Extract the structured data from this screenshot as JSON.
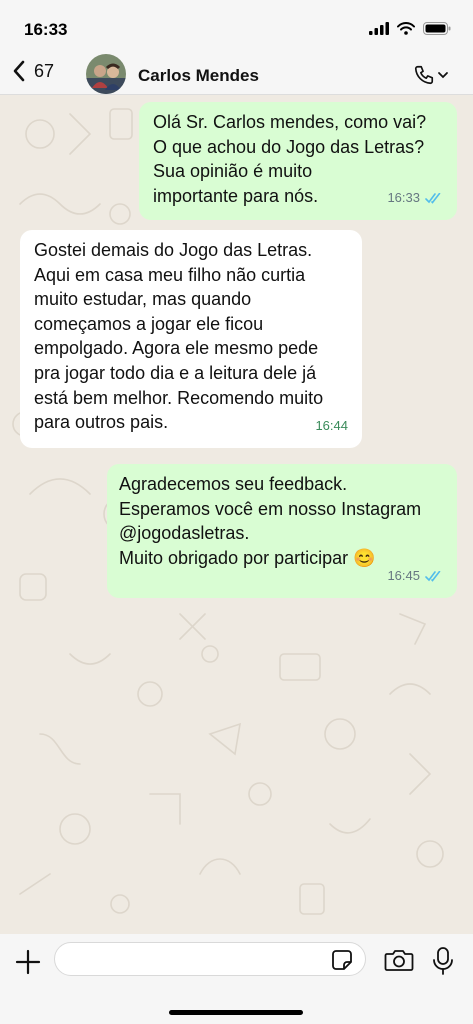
{
  "status_bar": {
    "time": "16:33"
  },
  "header": {
    "back_count": "67",
    "contact_name": "Carlos Mendes"
  },
  "messages": [
    {
      "direction": "outgoing",
      "text": "Olá Sr. Carlos mendes, como vai?\nO que achou do Jogo das Letras?\nSua opinião é muito\nimportante para nós.",
      "time": "16:33",
      "read": true
    },
    {
      "direction": "incoming",
      "text": "Gostei demais do Jogo das Letras.\nAqui em casa meu filho não curtia\nmuito estudar, mas quando\ncomeçamos a jogar ele ficou\nempolgado. Agora ele mesmo pede\npra jogar todo dia e a leitura dele já\nestá bem melhor. Recomendo muito\npara outros pais.",
      "time": "16:44"
    },
    {
      "direction": "outgoing",
      "text": "Agradecemos seu feedback.\nEsperamos você em nosso Instagram\n@jogodasletras.\nMuito obrigado por participar 😊",
      "time": "16:45",
      "read": true
    }
  ],
  "composer": {
    "placeholder": ""
  },
  "colors": {
    "outgoing_bubble": "#d9fdd3",
    "incoming_bubble": "#ffffff",
    "wallpaper": "#efeae2",
    "read_ticks": "#53bdeb"
  },
  "icons": [
    "signal-icon",
    "wifi-icon",
    "battery-icon",
    "back-chevron-icon",
    "phone-icon",
    "chevron-down-icon",
    "plus-icon",
    "sticker-icon",
    "camera-icon",
    "mic-icon"
  ]
}
